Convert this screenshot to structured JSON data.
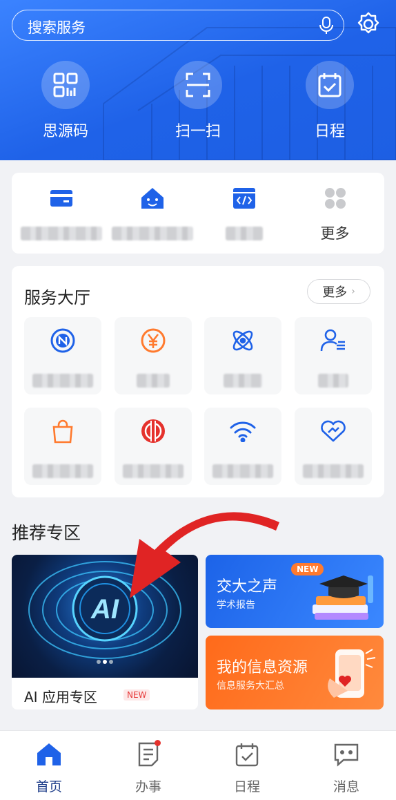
{
  "header": {
    "search_placeholder": "搜索服务",
    "quick_actions": [
      {
        "label": "思源码",
        "icon": "qr-code-icon"
      },
      {
        "label": "扫一扫",
        "icon": "scan-icon"
      },
      {
        "label": "日程",
        "icon": "calendar-icon"
      }
    ],
    "colors": {
      "primary": "#1f62e8",
      "light": "#3b83ff"
    }
  },
  "shortcuts": {
    "items": [
      {
        "icon": "card-icon",
        "label_blurred": true
      },
      {
        "icon": "home-icon",
        "label_blurred": true
      },
      {
        "icon": "code-window-icon",
        "label_blurred": true
      },
      {
        "icon": "grid-more-icon",
        "label": "更多"
      }
    ]
  },
  "service_hall": {
    "title": "服务大厅",
    "more_label": "更多",
    "tiles": [
      {
        "icon": "n-circle-icon",
        "color": "#1f62e8",
        "label_blurred": true
      },
      {
        "icon": "yuan-icon",
        "color": "#ff7a2e",
        "label_blurred": true
      },
      {
        "icon": "atom-icon",
        "color": "#1f62e8",
        "label_blurred": true
      },
      {
        "icon": "user-list-icon",
        "color": "#1f62e8",
        "label_blurred": true
      },
      {
        "icon": "shopping-bag-icon",
        "color": "#ff7a2e",
        "label_blurred": true
      },
      {
        "icon": "union-emblem-icon",
        "color": "#e5322d",
        "label_blurred": true
      },
      {
        "icon": "wifi-icon",
        "color": "#1f62e8",
        "label_blurred": true
      },
      {
        "icon": "heart-hands-icon",
        "color": "#1f62e8",
        "label_blurred": true
      }
    ]
  },
  "recommend": {
    "title": "推荐专区",
    "ai_banner": {
      "image_text": "AI",
      "label": "AI 应用专区",
      "tag": "NEW"
    },
    "banners": [
      {
        "title": "交大之声",
        "subtitle": "学术报告",
        "badge": "NEW"
      },
      {
        "title": "我的信息资源",
        "subtitle": "信息服务大汇总"
      }
    ]
  },
  "tabbar": {
    "tabs": [
      {
        "label": "首页",
        "icon": "home-tab-icon",
        "active": true
      },
      {
        "label": "办事",
        "icon": "document-tab-icon",
        "badge_dot": true
      },
      {
        "label": "日程",
        "icon": "calendar-tab-icon"
      },
      {
        "label": "消息",
        "icon": "message-tab-icon"
      }
    ]
  }
}
